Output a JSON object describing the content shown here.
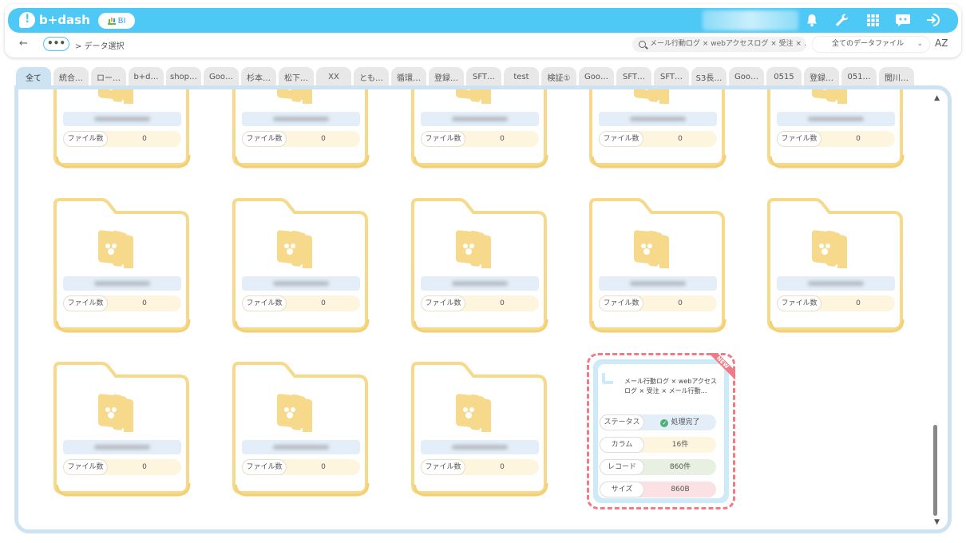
{
  "header": {
    "logo_text": "b+dash",
    "product_badge": "BI",
    "icons": [
      "bell-icon",
      "wrench-icon",
      "grid-icon",
      "chat-bot-icon",
      "logout-icon"
    ]
  },
  "breadcrumb": {
    "back": "←",
    "more": "•••",
    "current": "> データ選択"
  },
  "search": {
    "value": "メール行動ログ × webアクセスログ × 受注 × ..."
  },
  "file_filter": {
    "selected": "全てのデータファイル",
    "chevron": "⌄"
  },
  "sort_label": "AZ",
  "tabs": [
    {
      "label": "全て",
      "active": true
    },
    {
      "label": "統合…"
    },
    {
      "label": "ロー…"
    },
    {
      "label": "b+d…"
    },
    {
      "label": "shop…"
    },
    {
      "label": "Goo…"
    },
    {
      "label": "杉本…"
    },
    {
      "label": "松下…"
    },
    {
      "label": "XX"
    },
    {
      "label": "とも…"
    },
    {
      "label": "循環…"
    },
    {
      "label": "登録…"
    },
    {
      "label": "SFT…"
    },
    {
      "label": "test"
    },
    {
      "label": "検証①"
    },
    {
      "label": "Goo…"
    },
    {
      "label": "SFT…"
    },
    {
      "label": "SFT…"
    },
    {
      "label": "S3長…"
    },
    {
      "label": "Goo…"
    },
    {
      "label": "0515"
    },
    {
      "label": "登録…"
    },
    {
      "label": "051…"
    },
    {
      "label": "閲川…"
    }
  ],
  "folders": {
    "count_label": "ファイル数",
    "count_value": "0"
  },
  "new_card": {
    "badge": "NEW",
    "title": "メール行動ログ × webアクセスログ × 受注 × メール行動…",
    "rows": [
      {
        "label": "ステータス",
        "value": "処理完了",
        "color": "#e3eef8"
      },
      {
        "label": "カラム",
        "value": "16件",
        "color": "#fdf5de"
      },
      {
        "label": "レコード",
        "value": "860件",
        "color": "#e8f0e2"
      },
      {
        "label": "サイズ",
        "value": "860B",
        "color": "#fbe1e4"
      }
    ]
  },
  "colors": {
    "brand": "#4ec9f5",
    "folder": "#f6d98a",
    "highlight_dash": "#f07b87"
  }
}
